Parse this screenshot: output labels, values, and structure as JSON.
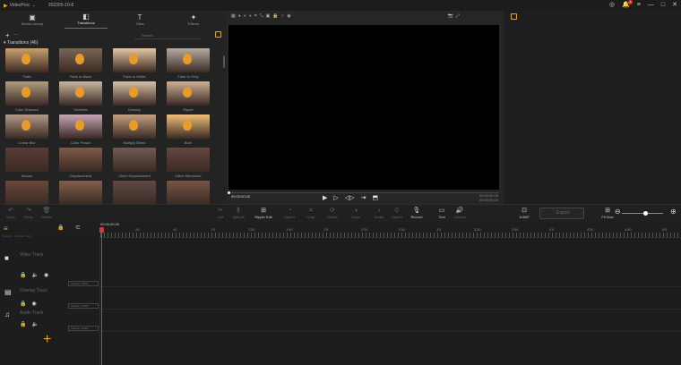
{
  "titlebar": {
    "app_name": "VideoProc",
    "project": "202305-10-8",
    "notif_count": "1"
  },
  "tabs": [
    {
      "label": "Media Library",
      "icon": "media-library-icon",
      "glyph": "▣"
    },
    {
      "label": "Transitions",
      "icon": "transitions-icon",
      "glyph": "◧"
    },
    {
      "label": "Titles",
      "icon": "titles-icon",
      "glyph": "T"
    },
    {
      "label": "Effects",
      "icon": "effects-icon",
      "glyph": "✦"
    }
  ],
  "search": {
    "placeholder": "Search..."
  },
  "section": {
    "title": "Transitions (46)"
  },
  "transitions": [
    {
      "label": "Fade",
      "tone": "#c9a070"
    },
    {
      "label": "Fade to Black",
      "tone": "#7a6656"
    },
    {
      "label": "Fade to White",
      "tone": "#e4c7a6"
    },
    {
      "label": "Fade to Grey",
      "tone": "#b6aca2"
    },
    {
      "label": "Color Distance",
      "tone": "#b29d7f"
    },
    {
      "label": "Directive",
      "tone": "#c9b6a0"
    },
    {
      "label": "Dreamy",
      "tone": "#d8c0a8"
    },
    {
      "label": "Ripple",
      "tone": "#ccb194"
    },
    {
      "label": "Linear Blur",
      "tone": "#b49a86"
    },
    {
      "label": "Color Phase",
      "tone": "#c8a6b4"
    },
    {
      "label": "Multiply Blend",
      "tone": "#c49f80"
    },
    {
      "label": "Burn",
      "tone": "#f0c07a"
    },
    {
      "label": "Mosaic",
      "tone": "#5b3c36"
    },
    {
      "label": "Displacement",
      "tone": "#7e5a48"
    },
    {
      "label": "Glitch Displacement",
      "tone": "#6e5a52"
    },
    {
      "label": "Glitch Memories",
      "tone": "#64473f"
    },
    {
      "label": "",
      "tone": "#6a463c"
    },
    {
      "label": "",
      "tone": "#805e4c"
    },
    {
      "label": "",
      "tone": "#5e4a44"
    },
    {
      "label": "",
      "tone": "#7a5446"
    }
  ],
  "preview": {
    "time_current": "00:00:00.00",
    "time_total_line1": "00:00:00.00",
    "time_total_line2": "00:00:00.00"
  },
  "toolbar": [
    {
      "label": "Undo",
      "icon": "undo-icon",
      "glyph": "↶",
      "on": false
    },
    {
      "label": "Redo",
      "icon": "redo-icon",
      "glyph": "↷",
      "on": false
    },
    {
      "label": "Delete",
      "icon": "delete-icon",
      "glyph": "🗑",
      "on": false
    },
    {
      "label": "Cut",
      "icon": "cut-icon",
      "glyph": "✂",
      "on": false
    },
    {
      "label": "Split All",
      "icon": "split-icon",
      "glyph": "⫼",
      "on": false
    },
    {
      "label": "Ripple Edit",
      "icon": "ripple-edit-icon",
      "glyph": "⊞",
      "on": true
    },
    {
      "label": "Speed",
      "icon": "speed-icon",
      "glyph": "◔",
      "on": false
    },
    {
      "label": "Crop",
      "icon": "crop-icon",
      "glyph": "⌗",
      "on": false
    },
    {
      "label": "Rotate",
      "icon": "rotate-icon",
      "glyph": "⟳",
      "on": false
    },
    {
      "label": "Color",
      "icon": "color-icon",
      "glyph": "◑",
      "on": false
    },
    {
      "label": "Audio",
      "icon": "audio-icon",
      "glyph": "♪",
      "on": false
    },
    {
      "label": "Speed",
      "icon": "speed2-icon",
      "glyph": "⏲",
      "on": false
    },
    {
      "label": "Record",
      "icon": "mic-icon",
      "glyph": "🎙",
      "on": true
    },
    {
      "label": "Text",
      "icon": "text-icon",
      "glyph": "▭",
      "on": true
    },
    {
      "label": "Volume",
      "icon": "volume-icon",
      "glyph": "🔊",
      "on": false
    }
  ],
  "export": {
    "label": "Export",
    "quality": "1080P",
    "fit": "Fit Size"
  },
  "timeline": {
    "start_time": "00:00:00.00",
    "ruler": [
      "00:00:00.00",
      "20",
      "40",
      "1'0",
      "1'20",
      "1'40",
      "2'0",
      "2'20",
      "2'40",
      "3'0",
      "3'20",
      "3'40",
      "4'0",
      "4'20",
      "4'40",
      "5'0"
    ],
    "tracks": [
      {
        "name": "Video Track",
        "icon": "video-track-icon",
        "glyph": "■",
        "opacity": "Opacity: 100%"
      },
      {
        "name": "Overlay Track",
        "icon": "overlay-track-icon",
        "glyph": "▤",
        "opacity": "Volume: 100%"
      },
      {
        "name": "Audio Track",
        "icon": "audio-track-icon",
        "glyph": "♫",
        "opacity": "Volume: 100%"
      }
    ],
    "subheader": "Subtitles · Subtitle Track"
  }
}
